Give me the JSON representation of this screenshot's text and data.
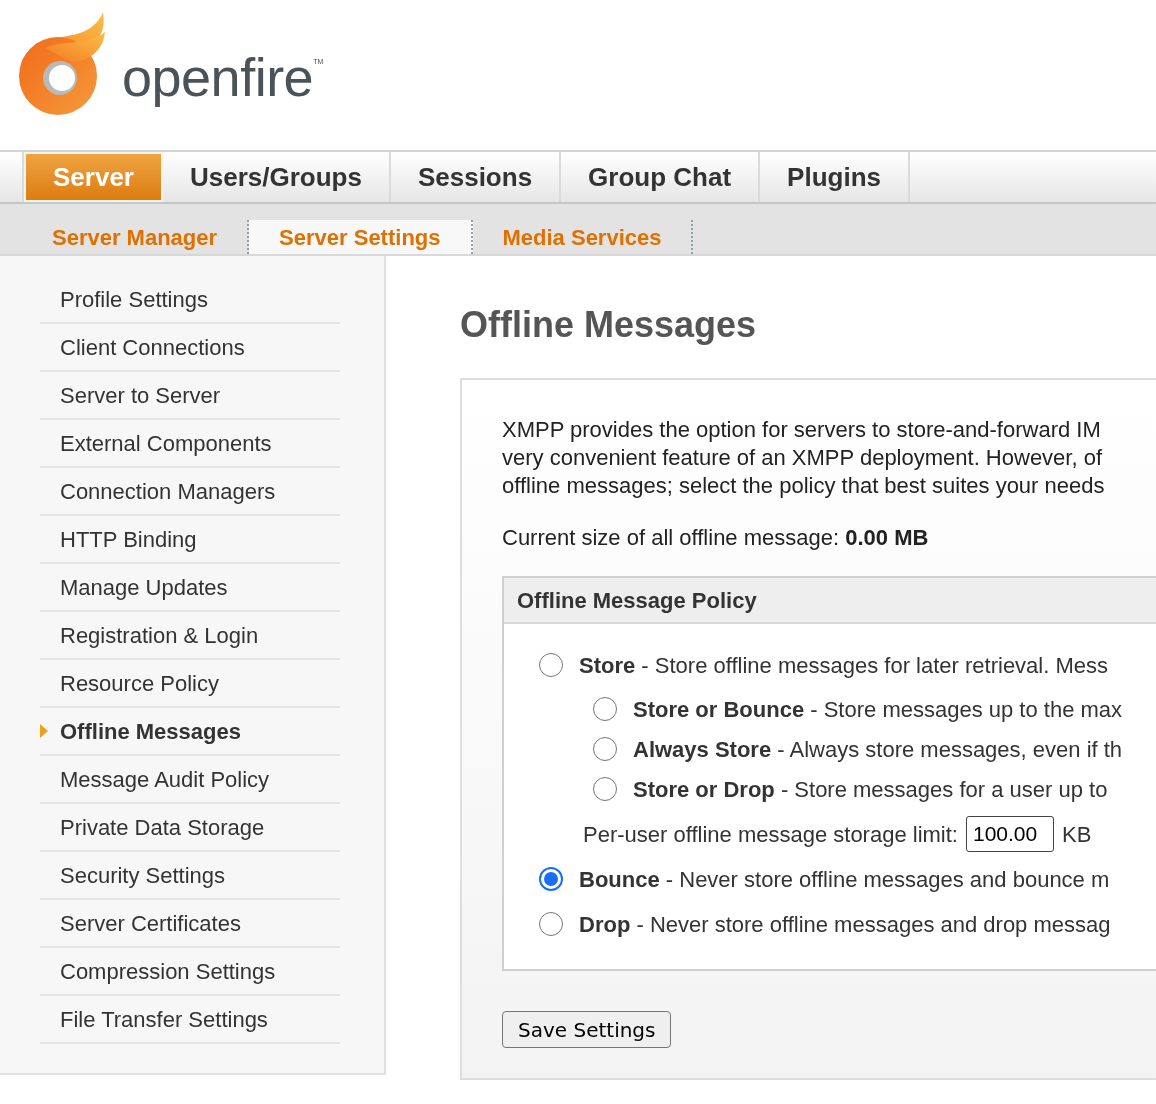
{
  "logo": {
    "wordmark": "openfire",
    "trademark": "TM"
  },
  "main_tabs": [
    {
      "label": "Server",
      "selected": true
    },
    {
      "label": "Users/Groups",
      "selected": false
    },
    {
      "label": "Sessions",
      "selected": false
    },
    {
      "label": "Group Chat",
      "selected": false
    },
    {
      "label": "Plugins",
      "selected": false
    }
  ],
  "sub_tabs": [
    {
      "label": "Server Manager",
      "selected": false
    },
    {
      "label": "Server Settings",
      "selected": true
    },
    {
      "label": "Media Services",
      "selected": false
    }
  ],
  "sidebar": {
    "items": [
      {
        "label": "Profile Settings",
        "selected": false
      },
      {
        "label": "Client Connections",
        "selected": false
      },
      {
        "label": "Server to Server",
        "selected": false
      },
      {
        "label": "External Components",
        "selected": false
      },
      {
        "label": "Connection Managers",
        "selected": false
      },
      {
        "label": "HTTP Binding",
        "selected": false
      },
      {
        "label": "Manage Updates",
        "selected": false
      },
      {
        "label": "Registration & Login",
        "selected": false
      },
      {
        "label": "Resource Policy",
        "selected": false
      },
      {
        "label": "Offline Messages",
        "selected": true
      },
      {
        "label": "Message Audit Policy",
        "selected": false
      },
      {
        "label": "Private Data Storage",
        "selected": false
      },
      {
        "label": "Security Settings",
        "selected": false
      },
      {
        "label": "Server Certificates",
        "selected": false
      },
      {
        "label": "Compression Settings",
        "selected": false
      },
      {
        "label": "File Transfer Settings",
        "selected": false
      }
    ]
  },
  "page": {
    "title": "Offline Messages",
    "description_lines": [
      "XMPP provides the option for servers to store-and-forward IM",
      "very convenient feature of an XMPP deployment. However, of",
      "offline messages; select the policy that best suites your needs"
    ],
    "size_summary": "Current size of all offline message: **0.00 MB**",
    "policy": {
      "title": "Offline Message Policy",
      "options": [
        {
          "text": "**Store** - Store offline messages for later retrieval. Mess",
          "selected": false,
          "children": [
            {
              "text": "**Store or Bounce** - Store messages up to the max",
              "selected": false
            },
            {
              "text": "**Always Store** - Always store messages, even if th",
              "selected": false
            },
            {
              "text": "**Store or Drop** - Store messages for a user up to",
              "selected": false
            }
          ],
          "limit": {
            "label": "Per-user offline message storage limit:",
            "value": "100.00",
            "unit": "KB"
          }
        },
        {
          "text": "**Bounce** - Never store offline messages and bounce m",
          "selected": true
        },
        {
          "text": "**Drop** - Never store offline messages and drop messag",
          "selected": false
        }
      ]
    },
    "save_button": "Save Settings"
  }
}
